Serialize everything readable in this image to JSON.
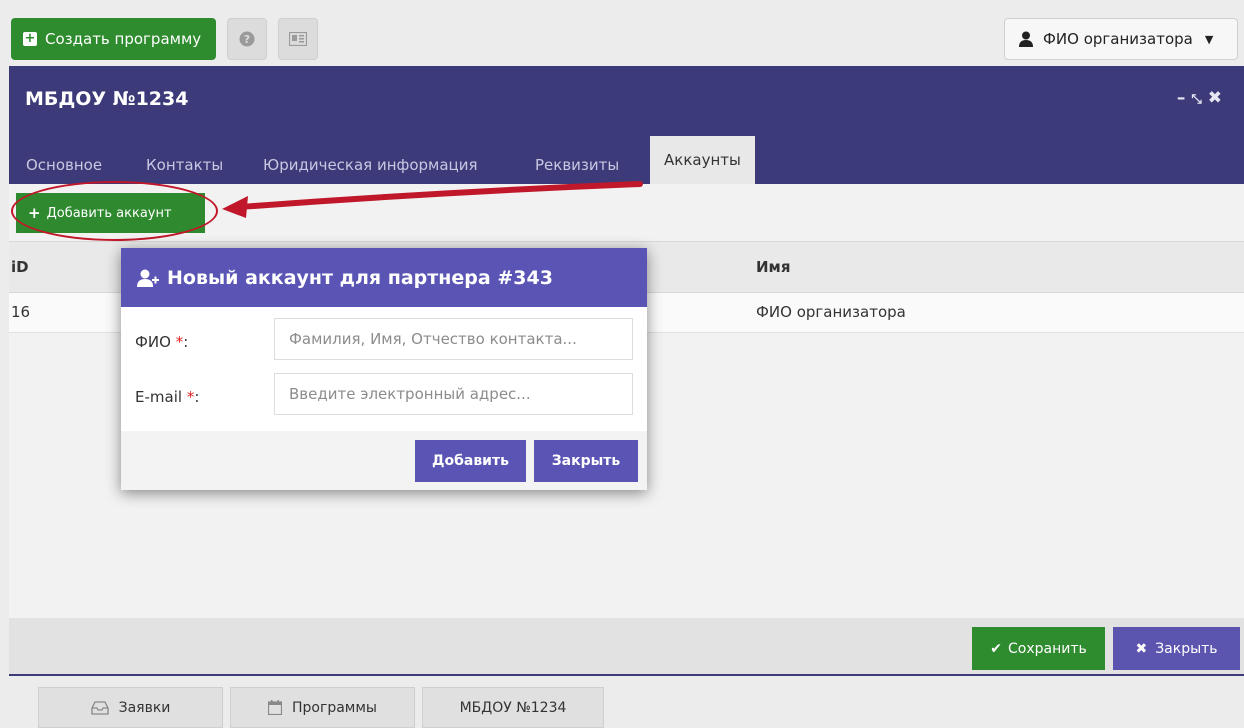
{
  "topbar": {
    "create_label": "Создать программу",
    "user_label": "ФИО организатора"
  },
  "panel": {
    "title": "МБДОУ №1234",
    "tabs": [
      "Основное",
      "Контакты",
      "Юридическая информация",
      "Реквизиты",
      "Аккаунты"
    ],
    "active_tab": "Аккаунты"
  },
  "accounts": {
    "add_label": "Добавить аккаунт",
    "columns": [
      "iD",
      "Имя"
    ],
    "rows": [
      {
        "id": "16",
        "name": "ФИО организатора"
      }
    ]
  },
  "modal": {
    "title": "Новый аккаунт для партнера #343",
    "fio_label": "ФИО",
    "email_label": "E-mail",
    "required_mark": "*",
    "colon": ":",
    "fio_placeholder": "Фамилия, Имя, Отчество контакта...",
    "email_placeholder": "Введите электронный адрес...",
    "add_button": "Добавить",
    "close_button": "Закрыть"
  },
  "footer": {
    "save_label": "Сохранить",
    "close_label": "Закрыть"
  },
  "taskbar": {
    "items": [
      "Заявки",
      "Программы",
      "МБДОУ №1234"
    ]
  },
  "colors": {
    "header_purple": "#3c3a78",
    "modal_purple": "#5a54b4",
    "green": "#2e8b2e",
    "annotation_red": "#c0182a"
  }
}
